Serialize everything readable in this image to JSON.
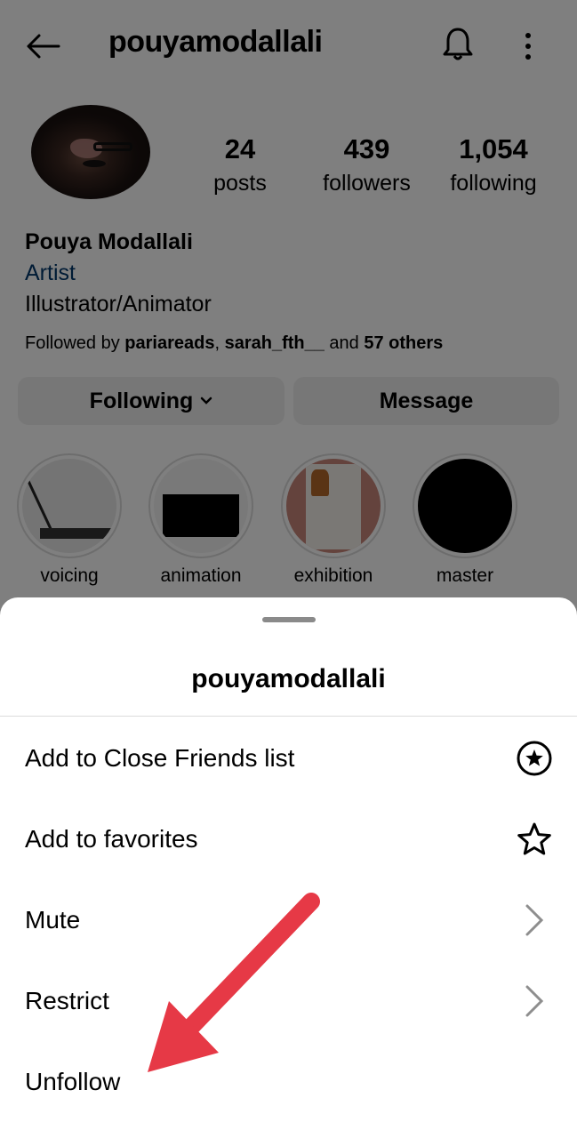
{
  "header": {
    "username": "pouyamodallali",
    "back_icon": "arrow-left-icon",
    "notification_icon": "bell-icon",
    "more_icon": "more-vertical-icon"
  },
  "profile": {
    "stats": [
      {
        "value": "24",
        "label": "posts"
      },
      {
        "value": "439",
        "label": "followers"
      },
      {
        "value": "1,054",
        "label": "following"
      }
    ],
    "full_name": "Pouya Modallali",
    "category": "Artist",
    "bio": "Illustrator/Animator",
    "followed_by": {
      "prefix": "Followed by ",
      "user1": "pariareads",
      "separator": ", ",
      "user2": "sarah_fth__",
      "middle": " and ",
      "others": "57 others"
    },
    "buttons": {
      "following_label": "Following",
      "message_label": "Message"
    },
    "highlights": [
      {
        "label": "voicing"
      },
      {
        "label": "animation"
      },
      {
        "label": "exhibition"
      },
      {
        "label": "master"
      }
    ]
  },
  "sheet": {
    "title": "pouyamodallali",
    "items": [
      {
        "label": "Add to Close Friends list",
        "icon": "close-friends-star-circle-icon"
      },
      {
        "label": "Add to favorites",
        "icon": "star-outline-icon"
      },
      {
        "label": "Mute",
        "icon": "chevron-right-icon"
      },
      {
        "label": "Restrict",
        "icon": "chevron-right-icon"
      },
      {
        "label": "Unfollow",
        "icon": ""
      }
    ]
  },
  "annotation": {
    "arrow_color": "#e63946",
    "points_to": "Unfollow"
  },
  "colors": {
    "category_link": "#00376b",
    "button_bg": "#efefef",
    "overlay": "rgba(0,0,0,0.5)"
  }
}
